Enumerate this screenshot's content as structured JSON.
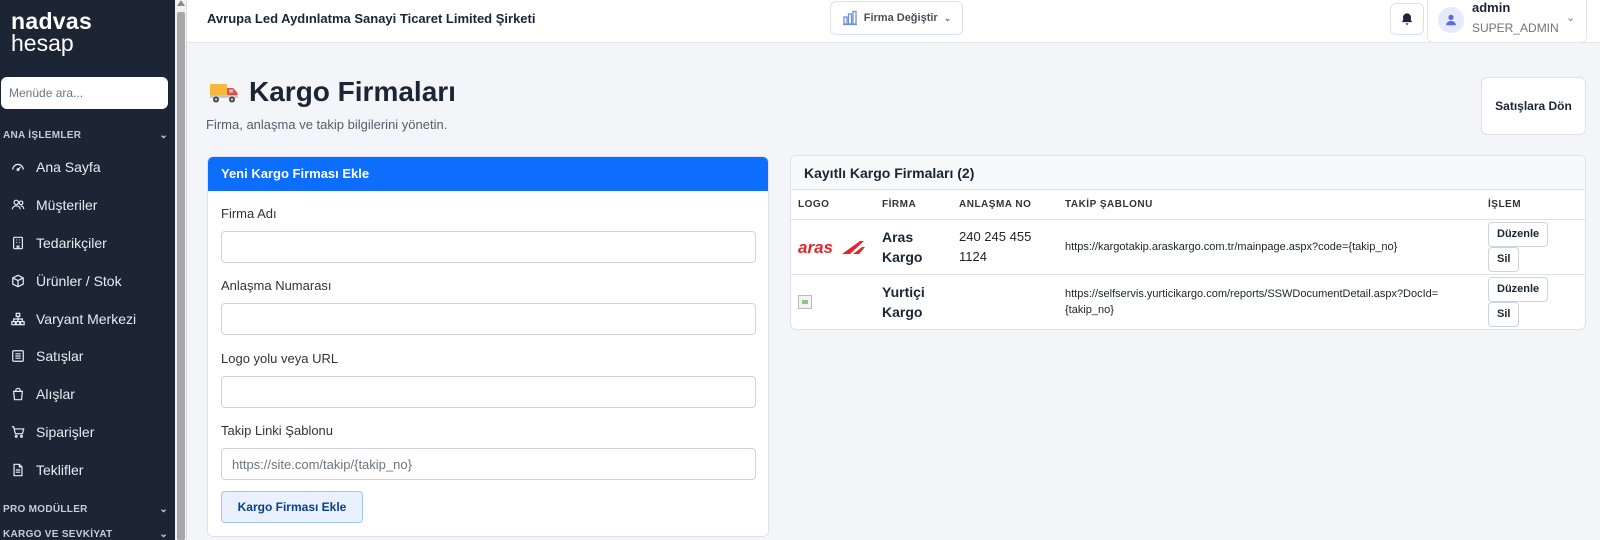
{
  "brand": {
    "line1": "nadvas",
    "line2": "hesap"
  },
  "sidebar": {
    "search_placeholder": "Menüde ara...",
    "section_main": "ANA İŞLEMLER",
    "items": [
      {
        "label": "Ana Sayfa",
        "icon": "dashboard-icon"
      },
      {
        "label": "Müşteriler",
        "icon": "users-icon"
      },
      {
        "label": "Tedarikçiler",
        "icon": "building-icon"
      },
      {
        "label": "Ürünler / Stok",
        "icon": "box-icon"
      },
      {
        "label": "Varyant Merkezi",
        "icon": "hierarchy-icon"
      },
      {
        "label": "Satışlar",
        "icon": "receipt-icon"
      },
      {
        "label": "Alışlar",
        "icon": "bag-icon"
      },
      {
        "label": "Siparişler",
        "icon": "cart-icon"
      },
      {
        "label": "Teklifler",
        "icon": "document-icon"
      }
    ],
    "section_pro": "PRO MODÜLLER",
    "section_cargo": "KARGO VE SEVKİYAT"
  },
  "topbar": {
    "company": "Avrupa Led Aydınlatma Sanayi Ticaret Limited Şirketi",
    "switch_label": "Firma Değiştir",
    "user": {
      "name": "admin",
      "role": "SUPER_ADMIN"
    }
  },
  "page": {
    "title": "Kargo Firmaları",
    "subtitle": "Firma, anlaşma ve takip bilgilerini yönetin.",
    "back_label": "Satışlara Dön"
  },
  "form": {
    "header": "Yeni Kargo Firması Ekle",
    "fields": [
      {
        "label": "Firma Adı",
        "value": "",
        "placeholder": ""
      },
      {
        "label": "Anlaşma Numarası",
        "value": "",
        "placeholder": ""
      },
      {
        "label": "Logo yolu veya URL",
        "value": "",
        "placeholder": ""
      },
      {
        "label": "Takip Linki Şablonu",
        "value": "",
        "placeholder": "https://site.com/takip/{takip_no}"
      }
    ],
    "submit_label": "Kargo Firması Ekle"
  },
  "list": {
    "header": "Kayıtlı Kargo Firmaları (2)",
    "columns": [
      "LOGO",
      "FİRMA",
      "ANLAŞMA NO",
      "TAKİP ŞABLONU",
      "İŞLEM"
    ],
    "rows": [
      {
        "logo_text": "aras",
        "firm_line1": "Aras",
        "firm_line2": "Kargo",
        "deal_line1": "240 245 455",
        "deal_line2": "1124",
        "template_line1": "https://kargotakip.araskargo.com.tr/mainpage.aspx?code={takip_no}",
        "template_line2": "",
        "edit_label": "Düzenle",
        "delete_label": "Sil"
      },
      {
        "logo_text": "",
        "firm_line1": "Yurtiçi",
        "firm_line2": "Kargo",
        "deal_line1": "",
        "deal_line2": "",
        "template_line1": "https://selfservis.yurticikargo.com/reports/SSWDocumentDetail.aspx?DocId=",
        "template_line2": "{takip_no}",
        "edit_label": "Düzenle",
        "delete_label": "Sil"
      }
    ]
  },
  "colors": {
    "primary": "#0d6efd",
    "sidebar_bg": "#1b2533",
    "aras_red": "#e3262c"
  }
}
